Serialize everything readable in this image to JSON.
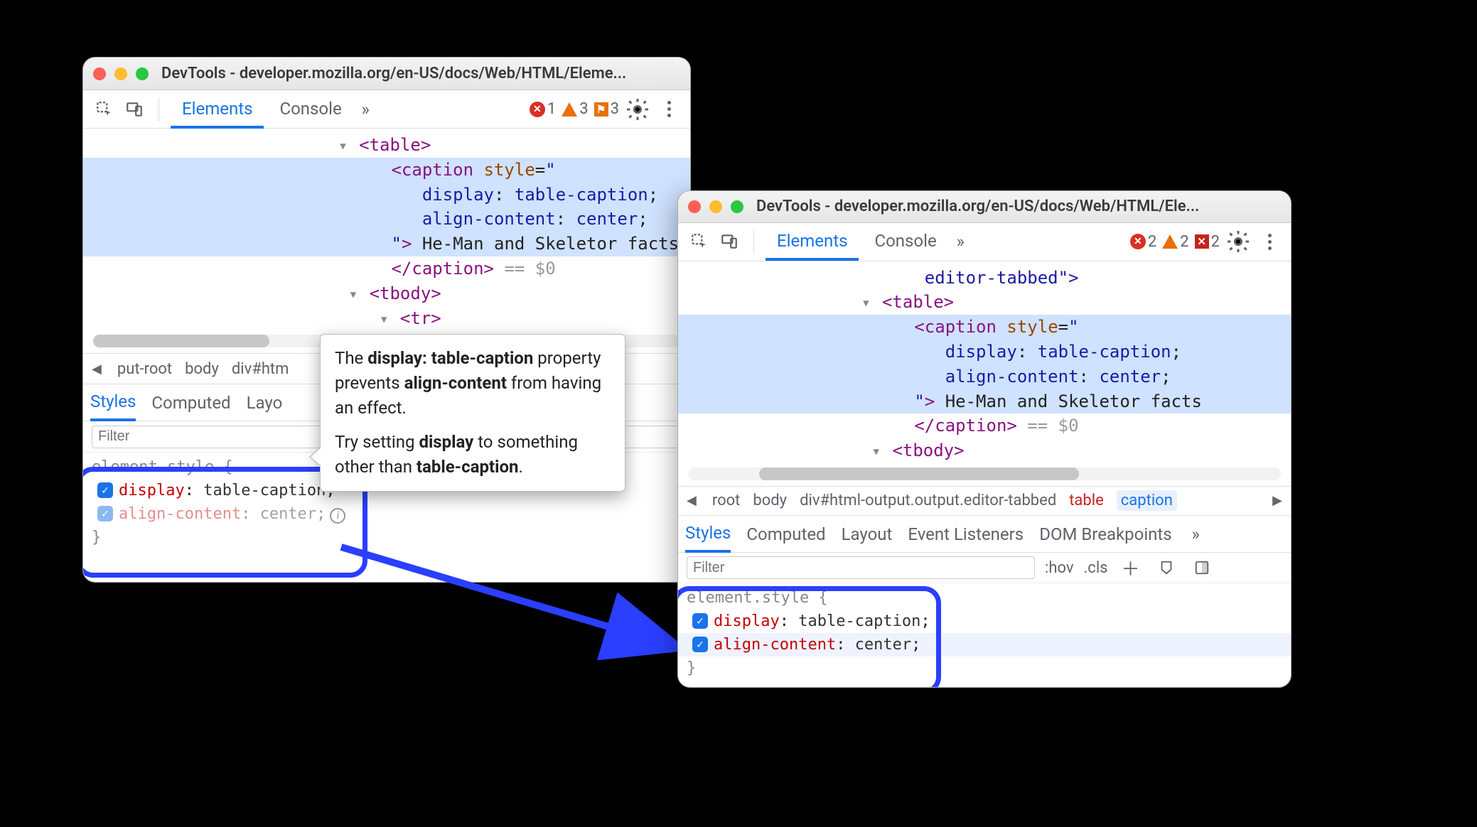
{
  "left": {
    "title": "DevTools - developer.mozilla.org/en-US/docs/Web/HTML/Eleme...",
    "tabs": {
      "elements": "Elements",
      "console": "Console",
      "more": "»"
    },
    "badges": {
      "errors": "1",
      "warnings": "3",
      "issues": "3"
    },
    "dom": {
      "table_open": "<table>",
      "caption_open": "<caption",
      "style_attr": "style",
      "s1_name": "display",
      "s1_val": "table-caption",
      "s2_name": "align-content",
      "s2_val": "center",
      "caption_text": "He-Man and Skeletor facts",
      "caption_close": "</caption>",
      "eqdollar": "== $0",
      "tbody_open": "<tbody>",
      "tr_open": "<tr>"
    },
    "breadcrumbs": {
      "b1": "put-root",
      "b2": "body",
      "b3": "div#htm"
    },
    "subtabs": {
      "styles": "Styles",
      "computed": "Computed",
      "layout": "Layo"
    },
    "filter_placeholder": "Filter",
    "styles": {
      "selector": "element.style {",
      "row1_name": "display",
      "row1_val": "table-caption",
      "row2_name": "align-content",
      "row2_val": "center",
      "brace_close": "}"
    },
    "tooltip": {
      "p1a": "The ",
      "p1b": "display: table-caption",
      "p1c": " property prevents ",
      "p1d": "align-content",
      "p1e": " from having an effect.",
      "p2a": "Try setting ",
      "p2b": "display",
      "p2c": " to something other than ",
      "p2d": "table-caption",
      "p2e": "."
    }
  },
  "right": {
    "title": "DevTools - developer.mozilla.org/en-US/docs/Web/HTML/Ele...",
    "tabs": {
      "elements": "Elements",
      "console": "Console",
      "more": "»"
    },
    "badges": {
      "errors": "2",
      "warnings": "2",
      "issues": "2"
    },
    "dom": {
      "prev_line": "editor-tabbed\">",
      "table_open": "<table>",
      "caption_open": "<caption",
      "style_attr": "style",
      "s1_name": "display",
      "s1_val": "table-caption",
      "s2_name": "align-content",
      "s2_val": "center",
      "caption_text": "He-Man and Skeletor facts",
      "caption_close": "</caption>",
      "eqdollar": "== $0",
      "tbody_open": "<tbody>"
    },
    "breadcrumbs": {
      "b1": "root",
      "b2": "body",
      "b3": "div#html-output.output.editor-tabbed",
      "b4": "table",
      "b5": "caption"
    },
    "subtabs": {
      "styles": "Styles",
      "computed": "Computed",
      "layout": "Layout",
      "events": "Event Listeners",
      "dom_bp": "DOM Breakpoints",
      "more": "»"
    },
    "filter_placeholder": "Filter",
    "filter_controls": {
      "hov": ":hov",
      "cls": ".cls"
    },
    "styles": {
      "selector": "element.style {",
      "row1_name": "display",
      "row1_val": "table-caption",
      "row2_name": "align-content",
      "row2_val": "center",
      "brace_close": "}"
    }
  }
}
